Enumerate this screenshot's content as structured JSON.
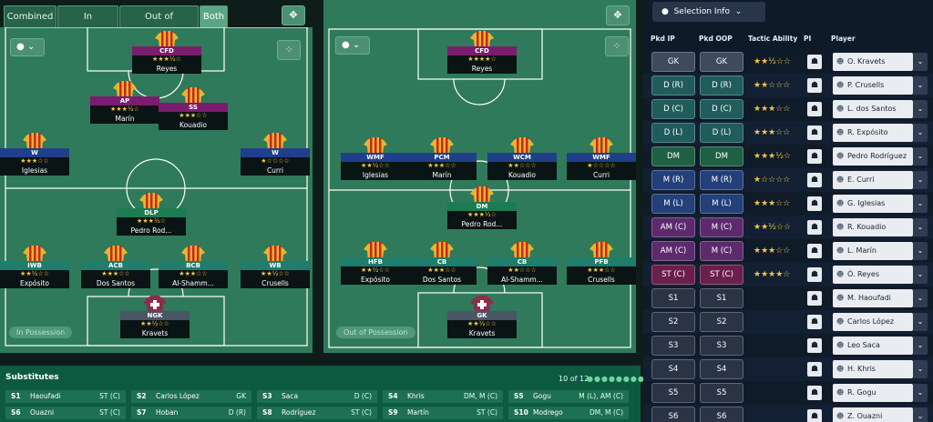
{
  "toolbar": {
    "tabs": [
      {
        "label": "Combined",
        "active": false
      },
      {
        "label": "In Possession",
        "active": false
      },
      {
        "label": "Out of Possession",
        "active": false
      },
      {
        "label": "Both",
        "active": true
      }
    ]
  },
  "pitch_left": {
    "label": "In Possession",
    "players": [
      {
        "role": "CFD",
        "stars": "★★★½☆",
        "name": "Reyes",
        "role_color": "#7b1c6e"
      },
      {
        "role": "AP",
        "stars": "★★★½☆",
        "name": "Marín",
        "role_color": "#7b1c6e"
      },
      {
        "role": "SS",
        "stars": "★★★☆☆",
        "name": "Kouadio",
        "role_color": "#7b1c6e"
      },
      {
        "role": "W",
        "stars": "★★★☆☆",
        "name": "Iglesias",
        "role_color": "#1f3f8a"
      },
      {
        "role": "W",
        "stars": "★☆☆☆☆",
        "name": "Curri",
        "role_color": "#1f3f8a"
      },
      {
        "role": "DLP",
        "stars": "★★★½☆",
        "name": "Pedro Rod...",
        "role_color": "#1d7b52"
      },
      {
        "role": "IWB",
        "stars": "★★½☆☆",
        "name": "Expósito",
        "role_color": "#1f7d6b"
      },
      {
        "role": "ACB",
        "stars": "★★★☆☆",
        "name": "Dos Santos",
        "role_color": "#1f7d6b"
      },
      {
        "role": "BCB",
        "stars": "★★★☆☆",
        "name": "Al-Shamm...",
        "role_color": "#1f7d6b"
      },
      {
        "role": "WB",
        "stars": "★★½☆☆",
        "name": "Crusells",
        "role_color": "#1f7d6b"
      },
      {
        "role": "NGK",
        "stars": "★★½☆☆",
        "name": "Kravets",
        "role_color": "#4a5566"
      }
    ]
  },
  "pitch_right": {
    "label": "Out of Possession",
    "players": [
      {
        "role": "CFD",
        "stars": "★★★★☆",
        "name": "Reyes",
        "role_color": "#7b1c6e"
      },
      {
        "role": "WMF",
        "stars": "★★½☆☆",
        "name": "Iglesias",
        "role_color": "#1f3f8a"
      },
      {
        "role": "PCM",
        "stars": "★★★☆☆",
        "name": "Marín",
        "role_color": "#1f3f8a"
      },
      {
        "role": "WCM",
        "stars": "★★☆☆☆",
        "name": "Kouadio",
        "role_color": "#1f3f8a"
      },
      {
        "role": "WMF",
        "stars": "★☆☆☆☆",
        "name": "Curri",
        "role_color": "#1f3f8a"
      },
      {
        "role": "DM",
        "stars": "★★★½☆",
        "name": "Pedro Rod...",
        "role_color": "#1d7b52"
      },
      {
        "role": "HFB",
        "stars": "★★½☆☆",
        "name": "Expósito",
        "role_color": "#1f7d6b"
      },
      {
        "role": "CB",
        "stars": "★★★☆☆",
        "name": "Dos Santos",
        "role_color": "#1f7d6b"
      },
      {
        "role": "CB",
        "stars": "★★☆☆☆",
        "name": "Al-Shamm...",
        "role_color": "#1f7d6b"
      },
      {
        "role": "PFB",
        "stars": "★★★☆☆",
        "name": "Crusells",
        "role_color": "#1f7d6b"
      },
      {
        "role": "GK",
        "stars": "★★½☆☆",
        "name": "Kravets",
        "role_color": "#4a5566"
      }
    ]
  },
  "substitutes": {
    "title": "Substitutes",
    "count": "10 of 12",
    "dots": "●●●●●●●●●●●●",
    "rows": [
      [
        {
          "slot": "S1",
          "name": "Haoufadi",
          "pos": "ST (C)"
        },
        {
          "slot": "S2",
          "name": "Carlos López",
          "pos": "GK"
        },
        {
          "slot": "S3",
          "name": "Saca",
          "pos": "D (C)"
        },
        {
          "slot": "S4",
          "name": "Khris",
          "pos": "DM, M (C)"
        },
        {
          "slot": "S5",
          "name": "Gogu",
          "pos": "M (L), AM (C)"
        }
      ],
      [
        {
          "slot": "S6",
          "name": "Ouazni",
          "pos": "ST (C)"
        },
        {
          "slot": "S7",
          "name": "Hoban",
          "pos": "D (R)"
        },
        {
          "slot": "S8",
          "name": "Rodríguez",
          "pos": "ST (C)"
        },
        {
          "slot": "S9",
          "name": "Martín",
          "pos": "ST (C)"
        },
        {
          "slot": "S10",
          "name": "Modrego",
          "pos": "DM, M (C)"
        }
      ]
    ]
  },
  "selection": {
    "dropdown_label": "Selection Info",
    "headers": {
      "ip": "Pkd IP",
      "oop": "Pkd OOP",
      "ability": "Tactic Ability",
      "pi": "PI",
      "player": "Player"
    },
    "rows": [
      {
        "ip": "GK",
        "oop": "GK",
        "stars": "★★½☆☆",
        "player": "O. Kravets",
        "color": "#3f4a5c"
      },
      {
        "ip": "D (R)",
        "oop": "D (R)",
        "stars": "★★☆☆☆",
        "player": "P. Crusells",
        "color": "#205c5c"
      },
      {
        "ip": "D (C)",
        "oop": "D (C)",
        "stars": "★★★☆☆",
        "player": "L. dos Santos",
        "color": "#205c5c"
      },
      {
        "ip": "D (L)",
        "oop": "D (L)",
        "stars": "★★★☆☆",
        "player": "R. Expósito",
        "color": "#205c5c"
      },
      {
        "ip": "DM",
        "oop": "DM",
        "stars": "★★★½☆",
        "player": "Pedro Rodríguez",
        "color": "#1f6045"
      },
      {
        "ip": "M (R)",
        "oop": "M (R)",
        "stars": "★☆☆☆☆",
        "player": "E. Curri",
        "color": "#24407a"
      },
      {
        "ip": "M (L)",
        "oop": "M (L)",
        "stars": "★★★☆☆",
        "player": "G. Iglesias",
        "color": "#24407a"
      },
      {
        "ip": "AM (C)",
        "oop": "M (C)",
        "stars": "★★½☆☆",
        "player": "R. Kouadio",
        "color": "#5e2a6e"
      },
      {
        "ip": "AM (C)",
        "oop": "M (C)",
        "stars": "★★★☆☆",
        "player": "L. Marín",
        "color": "#5e2a6e"
      },
      {
        "ip": "ST (C)",
        "oop": "ST (C)",
        "stars": "★★★★☆",
        "player": "Ó. Reyes",
        "color": "#6a1f4c"
      },
      {
        "ip": "S1",
        "oop": "S1",
        "stars": "",
        "player": "M. Haoufadi",
        "color": "#2a3445"
      },
      {
        "ip": "S2",
        "oop": "S2",
        "stars": "",
        "player": "Carlos López",
        "color": "#2a3445"
      },
      {
        "ip": "S3",
        "oop": "S3",
        "stars": "",
        "player": "Leo Saca",
        "color": "#2a3445"
      },
      {
        "ip": "S4",
        "oop": "S4",
        "stars": "",
        "player": "H. Khris",
        "color": "#2a3445"
      },
      {
        "ip": "S5",
        "oop": "S5",
        "stars": "",
        "player": "R. Gogu",
        "color": "#2a3445"
      },
      {
        "ip": "S6",
        "oop": "S6",
        "stars": "",
        "player": "Z. Ouazni",
        "color": "#2a3445"
      }
    ]
  }
}
